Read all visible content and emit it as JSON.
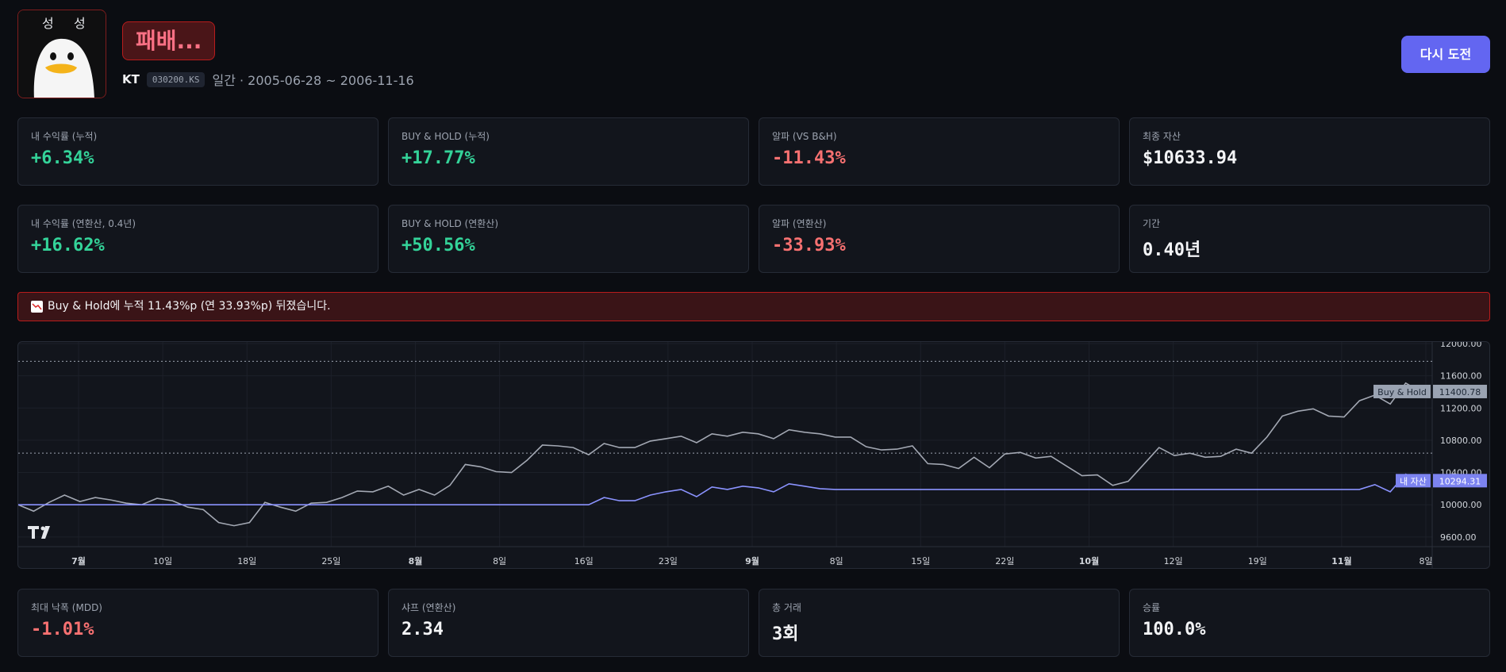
{
  "header": {
    "avatar": {
      "name": "avatar-duck",
      "badge_chars": [
        "성",
        "성"
      ]
    },
    "title": "패배...",
    "ticker_name": "KT",
    "ticker_code": "030200.KS",
    "period": "일간 · 2005-06-28 ~ 2006-11-16",
    "retry_label": "다시 도전"
  },
  "stats_row1": [
    {
      "label": "내 수익률 (누적)",
      "value": "+6.34%",
      "tone": "pos"
    },
    {
      "label": "BUY & HOLD (누적)",
      "value": "+17.77%",
      "tone": "pos"
    },
    {
      "label": "알파 (VS B&H)",
      "value": "-11.43%",
      "tone": "neg"
    },
    {
      "label": "최종 자산",
      "value": "$10633.94",
      "tone": "neu"
    }
  ],
  "stats_row2": [
    {
      "label": "내 수익률 (연환산, 0.4년)",
      "value": "+16.62%",
      "tone": "pos"
    },
    {
      "label": "BUY & HOLD (연환산)",
      "value": "+50.56%",
      "tone": "pos"
    },
    {
      "label": "알파 (연환산)",
      "value": "-33.93%",
      "tone": "neg"
    },
    {
      "label": "기간",
      "value": "0.40년",
      "tone": "neu"
    }
  ],
  "alert": {
    "icon": "chart-down-icon",
    "text": "Buy & Hold에 누적 11.43%p (연 33.93%p) 뒤졌습니다."
  },
  "chart_data": {
    "type": "line",
    "y_ticks": [
      "12000.00",
      "11600.00",
      "11200.00",
      "10800.00",
      "10400.00",
      "10000.00",
      "9600.00"
    ],
    "ylim": [
      9500,
      12000
    ],
    "x_tick_labels": [
      {
        "label": "7월",
        "bold": true
      },
      {
        "label": "10일",
        "bold": false
      },
      {
        "label": "18일",
        "bold": false
      },
      {
        "label": "25일",
        "bold": false
      },
      {
        "label": "8월",
        "bold": true
      },
      {
        "label": "8일",
        "bold": false
      },
      {
        "label": "16일",
        "bold": false
      },
      {
        "label": "23일",
        "bold": false
      },
      {
        "label": "9월",
        "bold": true
      },
      {
        "label": "8일",
        "bold": false
      },
      {
        "label": "15일",
        "bold": false
      },
      {
        "label": "22일",
        "bold": false
      },
      {
        "label": "10월",
        "bold": true
      },
      {
        "label": "12일",
        "bold": false
      },
      {
        "label": "19일",
        "bold": false
      },
      {
        "label": "11월",
        "bold": true
      },
      {
        "label": "8일",
        "bold": false
      }
    ],
    "reference_lines": [
      11780,
      10640
    ],
    "series": [
      {
        "name": "Buy & Hold",
        "color": "#a3a8b3",
        "last_label": "11400.78",
        "values": [
          10000,
          9920,
          10030,
          10120,
          10040,
          10090,
          10060,
          10020,
          10000,
          10080,
          10050,
          9970,
          9940,
          9780,
          9740,
          9780,
          10030,
          9970,
          9920,
          10020,
          10030,
          10090,
          10170,
          10160,
          10230,
          10120,
          10190,
          10120,
          10240,
          10500,
          10470,
          10410,
          10400,
          10550,
          10740,
          10730,
          10710,
          10620,
          10760,
          10710,
          10710,
          10790,
          10820,
          10850,
          10770,
          10880,
          10850,
          10900,
          10880,
          10820,
          10930,
          10900,
          10880,
          10840,
          10840,
          10720,
          10680,
          10690,
          10730,
          10510,
          10500,
          10450,
          10590,
          10460,
          10630,
          10650,
          10580,
          10600,
          10480,
          10360,
          10370,
          10240,
          10290,
          10500,
          10710,
          10610,
          10640,
          10590,
          10600,
          10690,
          10640,
          10840,
          11100,
          11160,
          11190,
          11100,
          11090,
          11290,
          11360,
          11250,
          11510,
          11400
        ]
      },
      {
        "name": "내 자산",
        "color": "#8b93ff",
        "last_label": "10294.31",
        "values": [
          10000,
          10000,
          10000,
          10000,
          10000,
          10000,
          10000,
          10000,
          10000,
          10000,
          10000,
          10000,
          10000,
          10000,
          10000,
          10000,
          10000,
          10000,
          10000,
          10000,
          10000,
          10000,
          10000,
          10000,
          10000,
          10000,
          10000,
          10000,
          10000,
          10000,
          10000,
          10000,
          10000,
          10000,
          10000,
          10000,
          10000,
          10000,
          10090,
          10050,
          10050,
          10120,
          10160,
          10190,
          10100,
          10220,
          10190,
          10230,
          10210,
          10160,
          10260,
          10230,
          10200,
          10190,
          10190,
          10190,
          10190,
          10190,
          10190,
          10190,
          10190,
          10190,
          10190,
          10190,
          10190,
          10190,
          10190,
          10190,
          10190,
          10190,
          10190,
          10190,
          10190,
          10190,
          10190,
          10190,
          10190,
          10190,
          10190,
          10190,
          10190,
          10190,
          10190,
          10190,
          10190,
          10190,
          10190,
          10190,
          10250,
          10160,
          10380,
          10294
        ]
      }
    ]
  },
  "stats_row3": [
    {
      "label": "최대 낙폭 (MDD)",
      "value": "-1.01%",
      "tone": "neg"
    },
    {
      "label": "샤프 (연환산)",
      "value": "2.34",
      "tone": "neu"
    },
    {
      "label": "총 거래",
      "value": "3회",
      "tone": "neu"
    },
    {
      "label": "승률",
      "value": "100.0%",
      "tone": "neu"
    }
  ],
  "colors": {
    "accent": "#6366f1",
    "positive": "#34d399",
    "negative": "#f87171"
  }
}
